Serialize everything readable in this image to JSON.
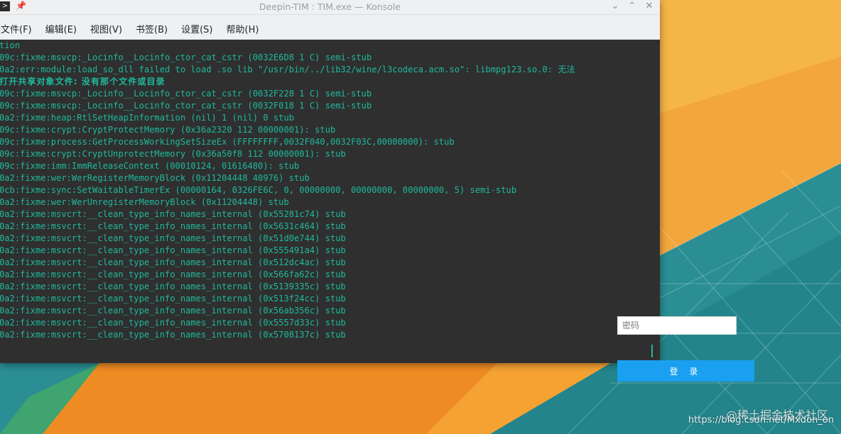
{
  "window": {
    "title": "Deepin-TIM : TIM.exe — Konsole",
    "menu": [
      "文件(F)",
      "编辑(E)",
      "视图(V)",
      "书签(B)",
      "设置(S)",
      "帮助(H)"
    ]
  },
  "terminal": {
    "lines": [
      "tion",
      "09c:fixme:msvcp:_Locinfo__Locinfo_ctor_cat_cstr (0032E6D8 1 C) semi-stub",
      "0a2:err:module:load_so_dll failed to load .so lib \"/usr/bin/../lib32/wine/l3codeca.acm.so\": libmpg123.so.0: 无法",
      "打开共享对象文件: 没有那个文件或目录",
      "09c:fixme:msvcp:_Locinfo__Locinfo_ctor_cat_cstr (0032F228 1 C) semi-stub",
      "09c:fixme:msvcp:_Locinfo__Locinfo_ctor_cat_cstr (0032F018 1 C) semi-stub",
      "0a2:fixme:heap:RtlSetHeapInformation (nil) 1 (nil) 0 stub",
      "09c:fixme:crypt:CryptProtectMemory (0x36a2320 112 00000001): stub",
      "09c:fixme:process:GetProcessWorkingSetSizeEx (FFFFFFFF,0032F040,0032F03C,00000000): stub",
      "09c:fixme:crypt:CryptUnprotectMemory (0x36a50f8 112 00000001): stub",
      "09c:fixme:imm:ImmReleaseContext (00010124, 01616480): stub",
      "0a2:fixme:wer:WerRegisterMemoryBlock (0x11204448 40976) stub",
      "0cb:fixme:sync:SetWaitableTimerEx (00000164, 0326FE6C, 0, 00000000, 00000000, 00000000, 5) semi-stub",
      "0a2:fixme:wer:WerUnregisterMemoryBlock (0x11204448) stub",
      "0a2:fixme:msvcrt:__clean_type_info_names_internal (0x55281c74) stub",
      "0a2:fixme:msvcrt:__clean_type_info_names_internal (0x5631c464) stub",
      "0a2:fixme:msvcrt:__clean_type_info_names_internal (0x51d0e744) stub",
      "0a2:fixme:msvcrt:__clean_type_info_names_internal (0x555491a4) stub",
      "0a2:fixme:msvcrt:__clean_type_info_names_internal (0x512dc4ac) stub",
      "0a2:fixme:msvcrt:__clean_type_info_names_internal (0x566fa62c) stub",
      "0a2:fixme:msvcrt:__clean_type_info_names_internal (0x5139335c) stub",
      "0a2:fixme:msvcrt:__clean_type_info_names_internal (0x513f24cc) stub",
      "0a2:fixme:msvcrt:__clean_type_info_names_internal (0x56ab356c) stub",
      "0a2:fixme:msvcrt:__clean_type_info_names_internal (0x5557d33c) stub",
      "0a2:fixme:msvcrt:__clean_type_info_names_internal (0x5708137c) stub"
    ],
    "text_color": "#1fb89c"
  },
  "login": {
    "password_placeholder": "密码",
    "login_button": "登 录",
    "accent": "#1aa0f0"
  },
  "watermark": {
    "line1": "@稀土掘金技术社区",
    "line2": "https://blog.csdn.net/Mxdon_on"
  },
  "icons": [
    "konsole-app-icon",
    "pin-icon",
    "minimize-icon",
    "maximize-icon",
    "close-icon"
  ]
}
